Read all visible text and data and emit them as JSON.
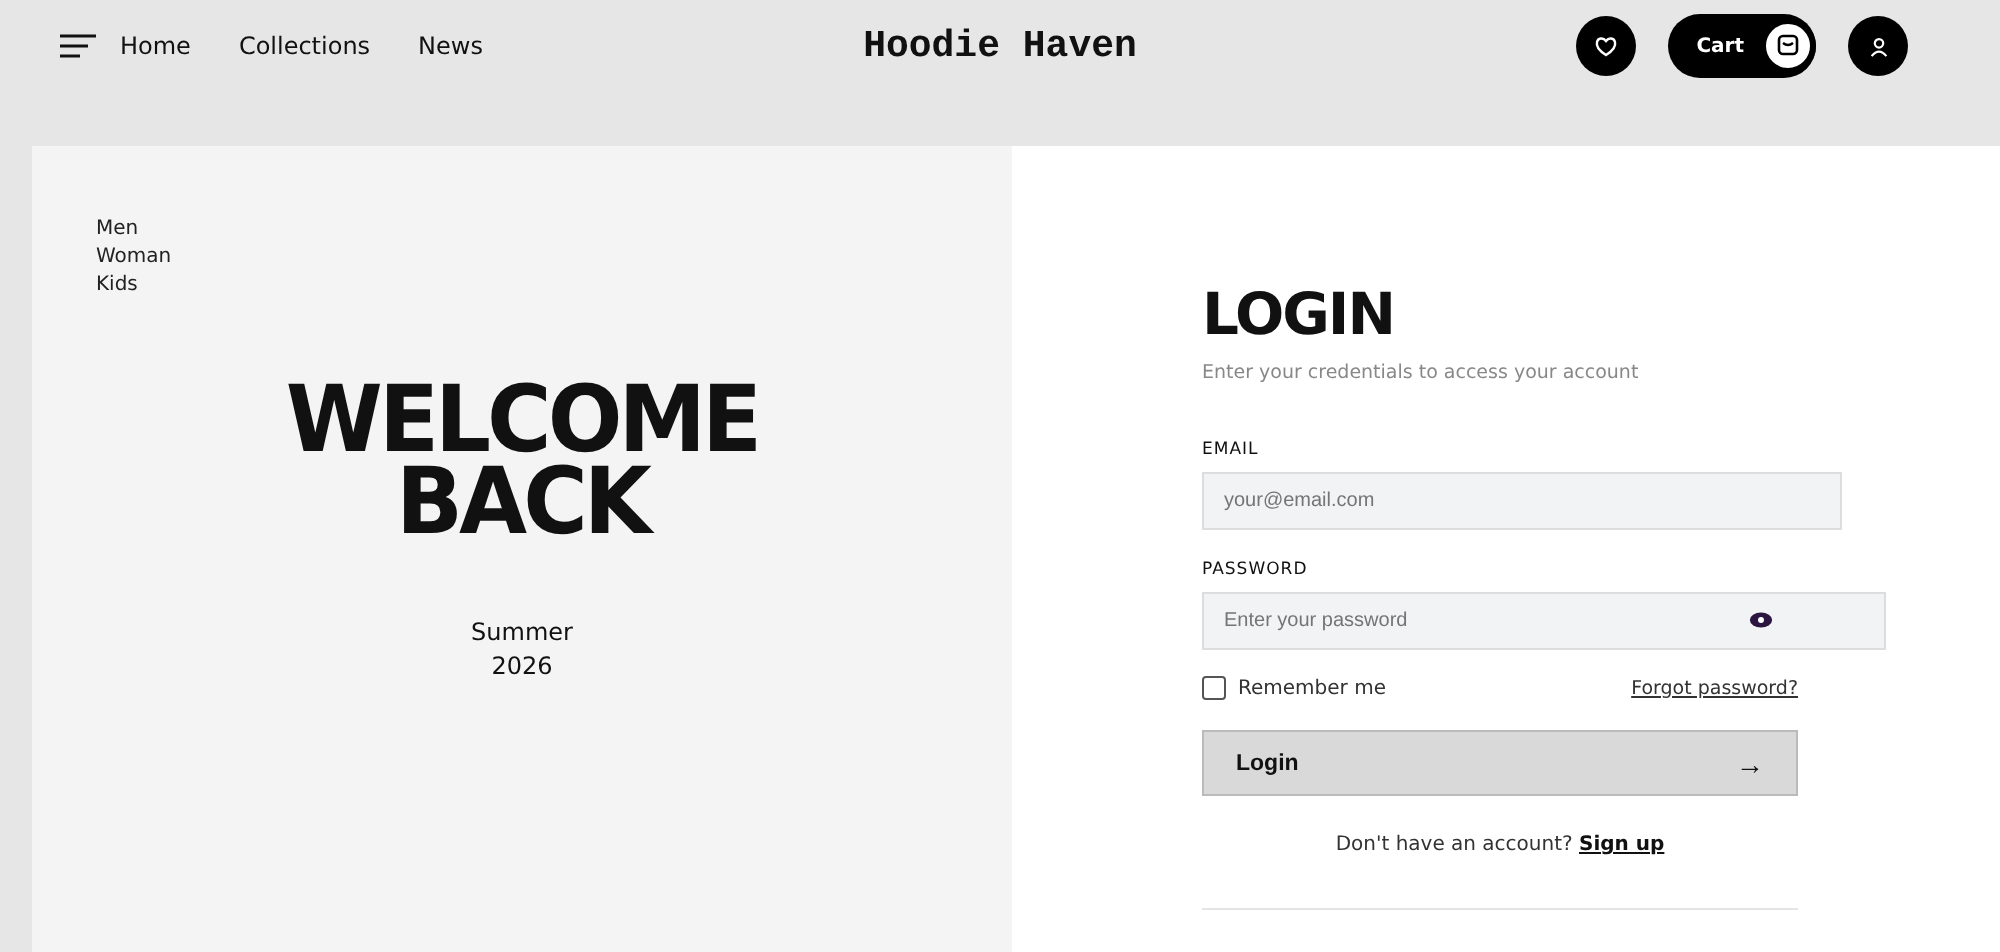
{
  "nav": {
    "links": [
      "Home",
      "Collections",
      "News"
    ]
  },
  "brand": "Hoodie Haven",
  "actions": {
    "cart": "Cart"
  },
  "categories": [
    "Men",
    "Woman",
    "Kids"
  ],
  "hero": {
    "title_lines": [
      "WELCOME",
      "BACK"
    ],
    "season_lines": [
      "Summer",
      "2026"
    ]
  },
  "login": {
    "title": "LOGIN",
    "subtitle": "Enter your credentials to access your account",
    "email": {
      "label": "EMAIL",
      "placeholder": "your@email.com"
    },
    "password": {
      "label": "PASSWORD",
      "placeholder": "Enter your password"
    },
    "remember": {
      "label": "Remember me",
      "checked": false
    },
    "forgot": "Forgot password?",
    "submit": {
      "label": "Login",
      "arrow": "→"
    },
    "signup_prompt": "Don't have an account?",
    "signup_link": "Sign up"
  }
}
